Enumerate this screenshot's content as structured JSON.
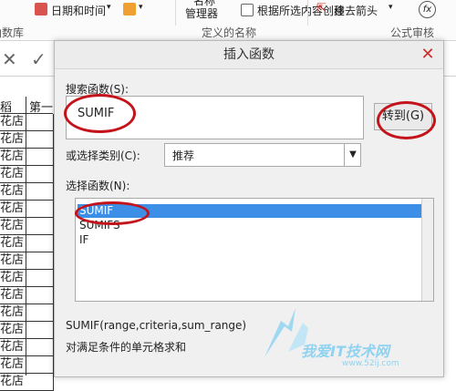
{
  "ribbon": {
    "datetime_label": "日期和时间",
    "name_manager_top": "名称",
    "name_manager": "管理器",
    "create_from_selection": "根据所选内容创建",
    "remove_arrows": "移去箭头",
    "group_library": "函数库",
    "group_defined_names": "定义的名称",
    "group_formula_audit": "公式审核"
  },
  "formula_bar": {
    "cancel_glyph": "✕",
    "enter_glyph": "✓"
  },
  "sheet": {
    "header_cell_a": "稻",
    "header_cell_b": "第一",
    "rows": [
      "花店",
      "花店",
      "花店",
      "花店",
      "花店",
      "花店",
      "花店",
      "花店",
      "花店",
      "花店",
      "花店",
      "花店",
      "花店",
      "花店",
      "花店",
      "花店"
    ]
  },
  "dialog": {
    "title": "插入函数",
    "close_glyph": "✕",
    "search_label": "搜索函数(S):",
    "search_value": "SUMIF",
    "go_button": "转到(G)",
    "category_label": "或选择类别(C):",
    "category_value": "推荐",
    "select_label": "选择函数(N):",
    "functions": [
      "SUMIF",
      "SUMIFS",
      "IF"
    ],
    "selected_index": 0,
    "signature": "SUMIF(range,criteria,sum_range)",
    "description": "对满足条件的单元格求和"
  },
  "watermark": {
    "brand": "我爱IT技术网",
    "url": "www.52ij.com"
  },
  "colors": {
    "accent": "#3c8ee6",
    "annotation": "#c4141b",
    "watermark": "#8fd3f1"
  }
}
